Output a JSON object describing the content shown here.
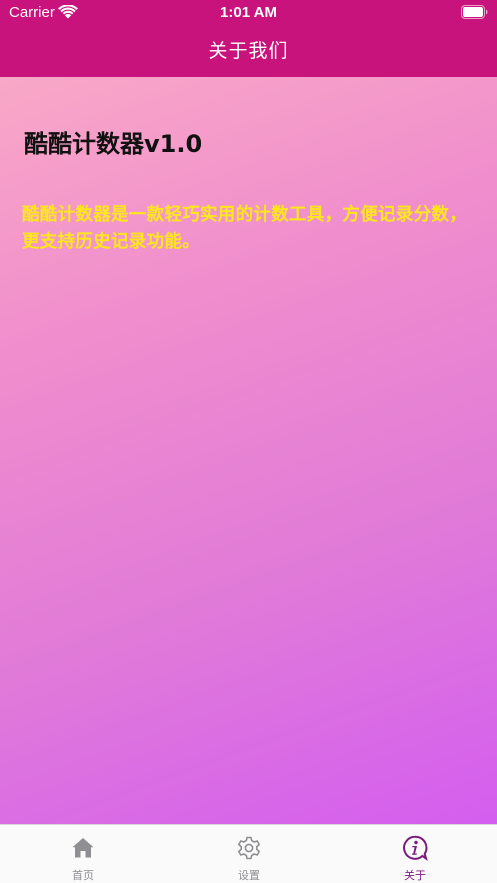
{
  "status_bar": {
    "carrier": "Carrier",
    "time": "1:01 AM"
  },
  "nav": {
    "title": "关于我们"
  },
  "main": {
    "app_title": "酷酷计数器v1.0",
    "description": "酷酷计数器是一款轻巧实用的计数工具，方便记录分数，更支持历史记录功能。"
  },
  "tabbar": {
    "tabs": [
      {
        "label": "首页",
        "icon": "home-icon",
        "active": false
      },
      {
        "label": "设置",
        "icon": "gear-icon",
        "active": false
      },
      {
        "label": "关于",
        "icon": "info-icon",
        "active": true
      }
    ]
  },
  "colors": {
    "nav_background": "#c8127c",
    "description_text": "#ffe81a",
    "active_tab": "#7a1a7e",
    "inactive_tab": "#8e8e93"
  }
}
